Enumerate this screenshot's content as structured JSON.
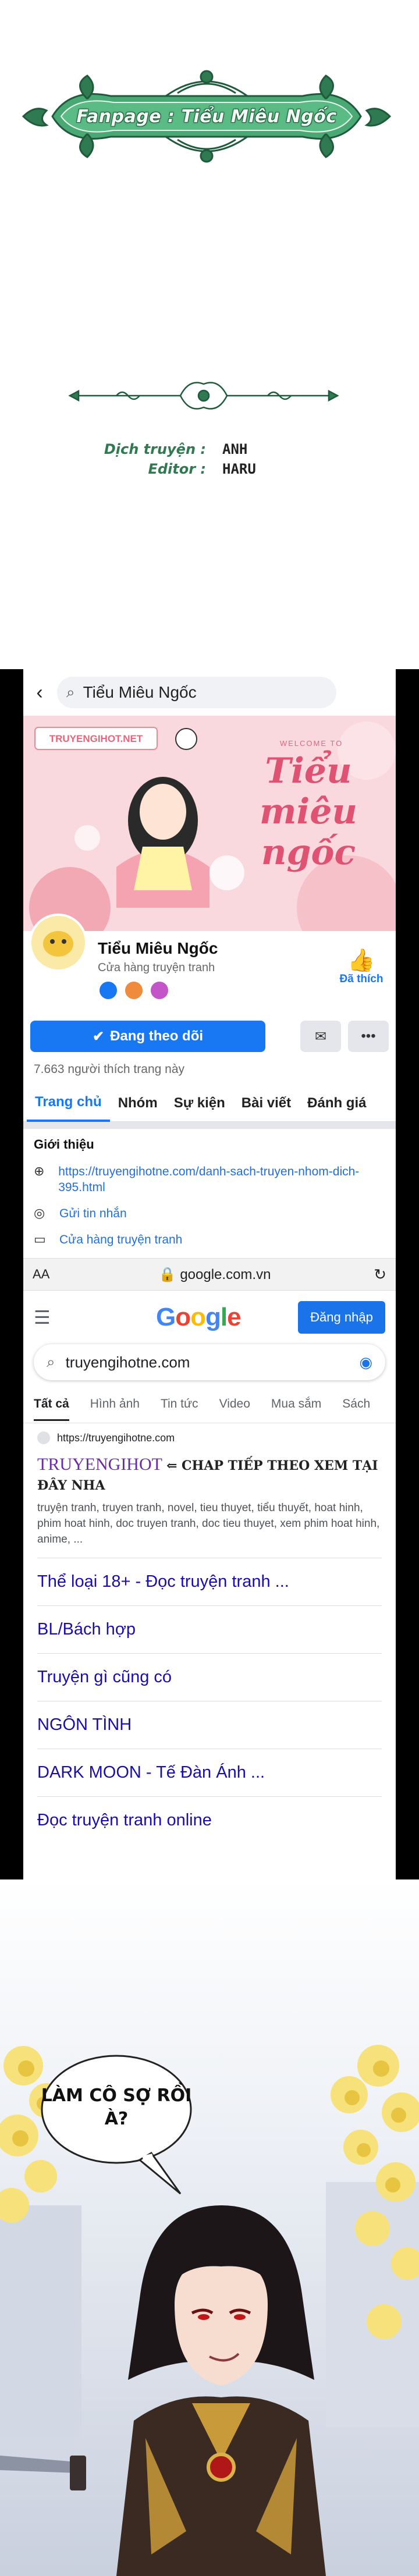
{
  "fanpage": {
    "label": "Fanpage : Tiểu Miêu Ngốc"
  },
  "credits": [
    {
      "label": "Dịch truyện :",
      "value": "ANH"
    },
    {
      "label": "Editor :",
      "value": "HARU"
    }
  ],
  "facebook": {
    "search_text": "Tiểu Miêu Ngốc",
    "cover": {
      "site_tag": "TRUYENGIHOT.NET",
      "welcome": "WELCOME TO",
      "script_title": "Tiểu miêu ngốc"
    },
    "page_name": "Tiểu Miêu Ngốc",
    "page_category": "Cửa hàng truyện tranh",
    "liked_label": "Đã thích",
    "follow_label": "Đang theo dõi",
    "more_label": "•••",
    "likes_count": "7.663 người thích trang này",
    "tabs": [
      "Trang chủ",
      "Nhóm",
      "Sự kiện",
      "Bài viết",
      "Đánh giá"
    ],
    "about": {
      "title": "Giới thiệu",
      "link": "https://truyengihotne.com/danh-sach-truyen-nhom-dich-395.html",
      "message": "Gửi tin nhắn",
      "shop": "Cửa hàng truyện tranh"
    }
  },
  "browser": {
    "aa": "AA",
    "url": "google.com.vn"
  },
  "google": {
    "logo": "Google",
    "login": "Đăng nhập",
    "query": "truyengihotne.com",
    "tabs": [
      "Tất cả",
      "Hình ảnh",
      "Tin tức",
      "Video",
      "Mua sắm",
      "Sách"
    ],
    "result": {
      "url": "https://truyengihotne.com",
      "title": "TRUYENGIHOT",
      "cta": "⇐ CHAP TIẾP THEO XEM TẠI ĐÂY NHA",
      "snippet": "truyện tranh, truyen tranh, novel, tieu thuyet, tiểu thuyết, hoat hinh, phim hoat hinh, doc truyen tranh, doc tieu thuyet, xem phim hoat hinh, anime, ...",
      "sitelinks": [
        "Thể loại 18+ - Đọc truyện tranh ...",
        "BL/Bách hợp",
        "Truyện gì cũng có",
        "NGÔN TÌNH",
        "DARK MOON - Tế Đàn Ánh ...",
        "Đọc truyện tranh online"
      ]
    }
  },
  "comic": {
    "speech": "LÀM CÔ SỢ RỒI À?"
  },
  "colors": {
    "fb_blue": "#1877f2",
    "google_blue": "#1a73e8",
    "ornament_green": "#2f7a50",
    "result_purple": "#6b2aa8"
  }
}
